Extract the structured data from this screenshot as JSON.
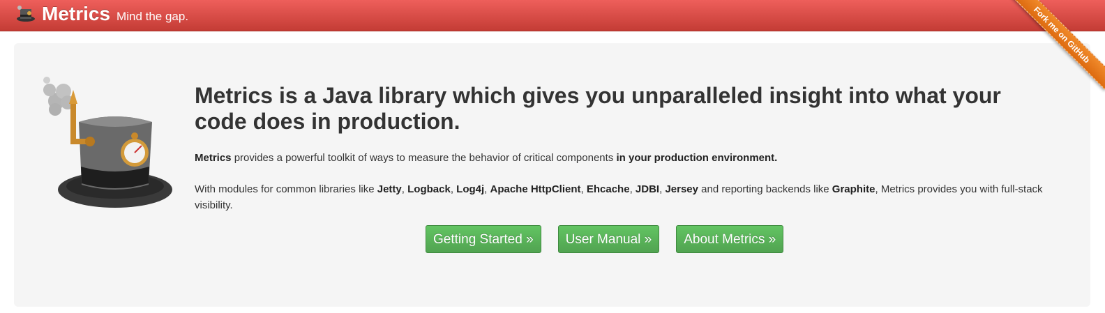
{
  "navbar": {
    "brand": "Metrics",
    "tagline": "Mind the gap.",
    "ribbon": "Fork me on GitHub"
  },
  "hero": {
    "headline": "Metrics is a Java library which gives you unparalleled insight into what your code does in production.",
    "p1": {
      "strong1": "Metrics",
      "text1": " provides a powerful toolkit of ways to measure the behavior of critical components ",
      "strong2": "in your production environment."
    },
    "p2": {
      "t0": "With modules for common libraries like ",
      "jetty": "Jetty",
      "c1": ", ",
      "logback": "Logback",
      "c2": ", ",
      "log4j": "Log4j",
      "c3": ", ",
      "httpclient": "Apache HttpClient",
      "c4": ", ",
      "ehcache": "Ehcache",
      "c5": ", ",
      "jdbi": "JDBI",
      "c6": ", ",
      "jersey": "Jersey",
      "t1": " and reporting backends like ",
      "graphite": "Graphite",
      "t2": ", Metrics provides you with full-stack visibility."
    },
    "buttons": [
      "Getting Started »",
      "User Manual »",
      "About Metrics »"
    ]
  },
  "icons": {
    "logo": "top-hat-logo-icon",
    "hero": "steampunk-top-hat-icon"
  },
  "colors": {
    "navbar": "#dd4b39",
    "button": "#5bb75b",
    "ribbon": "#e8761c",
    "hero_bg": "#f5f5f5"
  }
}
